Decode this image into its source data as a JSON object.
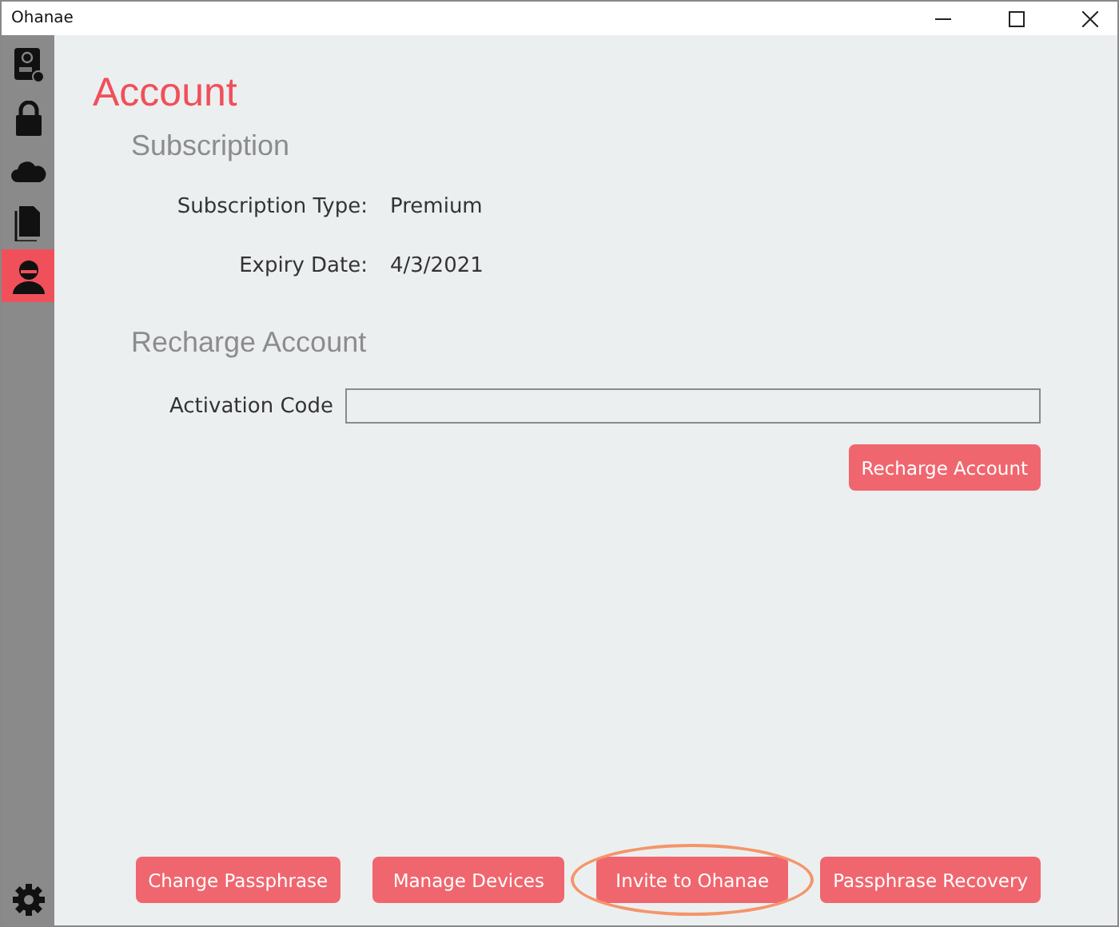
{
  "window": {
    "title": "Ohanae"
  },
  "sidebar": {
    "items": [
      {
        "kind": "drive",
        "selected": false
      },
      {
        "kind": "lock",
        "selected": false
      },
      {
        "kind": "cloud",
        "selected": false
      },
      {
        "kind": "files",
        "selected": false
      },
      {
        "kind": "user",
        "selected": true
      }
    ]
  },
  "page": {
    "title": "Account"
  },
  "subscription": {
    "heading": "Subscription",
    "fields": [
      {
        "label": "Subscription Type:",
        "value": "Premium"
      },
      {
        "label": "Expiry Date:",
        "value": "4/3/2021"
      }
    ]
  },
  "recharge": {
    "heading": "Recharge Account",
    "code_label": "Activation Code",
    "button": "Recharge Account"
  },
  "buttons": [
    {
      "label": "Change Passphrase",
      "highlighted": false
    },
    {
      "label": "Manage Devices",
      "highlighted": false
    },
    {
      "label": "Invite to Ohanae",
      "highlighted": true
    },
    {
      "label": "Passphrase Recovery",
      "highlighted": false
    }
  ]
}
